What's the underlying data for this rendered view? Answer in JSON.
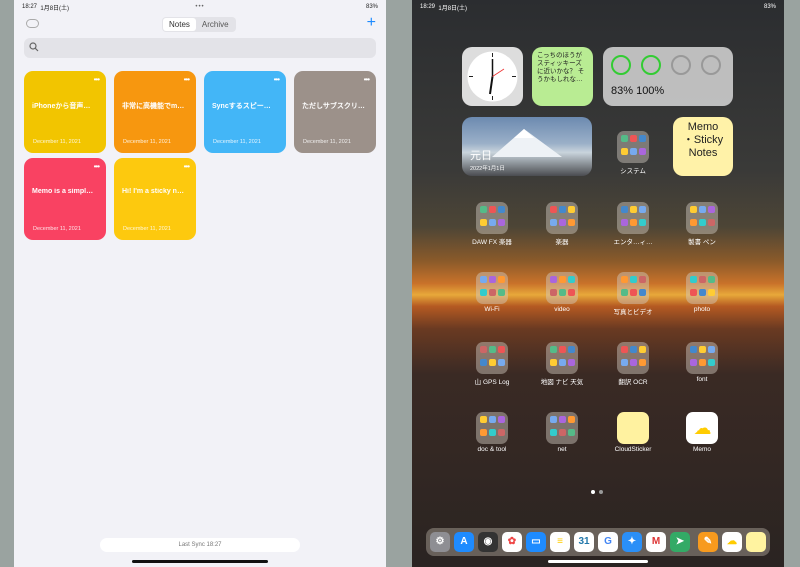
{
  "left": {
    "status": {
      "time": "18:27",
      "date": "1月8日(土)",
      "center": "•••",
      "battery": "83%"
    },
    "tabs": [
      "Notes",
      "Archive"
    ],
    "add": "+",
    "notes": [
      {
        "title": "iPhoneから音声…",
        "date": "December 11, 2021",
        "color": "#f2c500",
        "menu": "•••"
      },
      {
        "title": "非常に高機能でm…",
        "date": "December 11, 2021",
        "color": "#f7970f",
        "menu": "•••"
      },
      {
        "title": "Syncするスピー…",
        "date": "December 11, 2021",
        "color": "#43b6f7",
        "menu": "•••"
      },
      {
        "title": "ただしサブスクリ…",
        "date": "December 11, 2021",
        "color": "#9c918a",
        "menu": "•••"
      },
      {
        "title": "Memo is a simpl…",
        "date": "December 11, 2021",
        "color": "#f94262",
        "menu": "•••"
      },
      {
        "title": "Hi! I'm a sticky n…",
        "date": "December 11, 2021",
        "color": "#fdc90e",
        "menu": "•••"
      }
    ],
    "sync": "Last Sync 18:27"
  },
  "right": {
    "status": {
      "time": "18:29",
      "date": "1月8日(土)",
      "battery": "83%"
    },
    "sticky_widget": "こっちのほうがスティッキーズに近いかな？ そうかもしれな…",
    "battery_widget": "83% 100%",
    "photo_widget": {
      "title": "元日",
      "date": "2022年1月1日"
    },
    "system_label": "システム",
    "memo_widget": "Memo\n・Sticky\nNotes",
    "folders": [
      "DAW FX 楽器",
      "楽器",
      "エンタ…ィ…",
      "製書 ペン",
      "Wi-Fi",
      "video",
      "写真とビデオ",
      "photo",
      "山 GPS Log",
      "地図 ナビ 天気",
      "翻訳 OCR",
      "font",
      "doc & tool",
      "net",
      "CloudSticker",
      "Memo"
    ]
  },
  "colors": {
    "accent": "#1e8bff"
  }
}
